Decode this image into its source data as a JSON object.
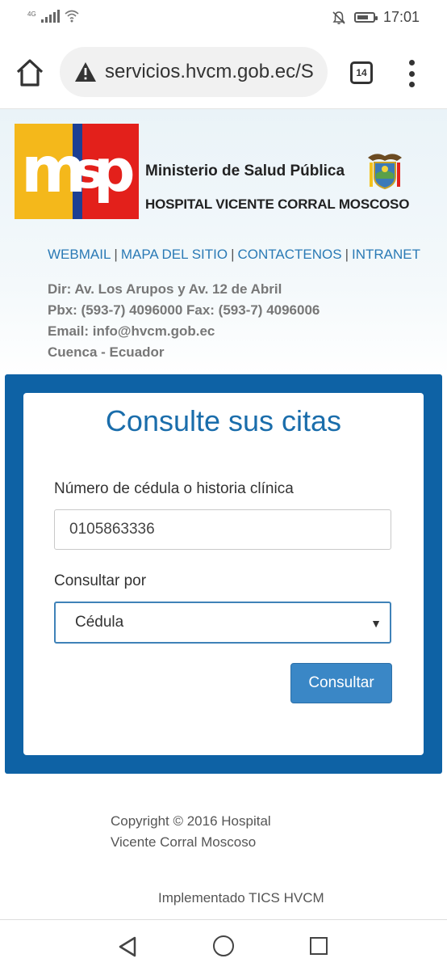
{
  "status_bar": {
    "network": "4G",
    "time": "17:01",
    "battery_level": 0.7
  },
  "browser": {
    "url": "servicios.hvcm.gob.ec/S",
    "tab_count": "14"
  },
  "header": {
    "logo_letters": {
      "m": "m",
      "s": "s",
      "p": "p"
    },
    "org_name": "Ministerio de Salud Pública",
    "hospital_name": "HOSPITAL VICENTE CORRAL MOSCOSO"
  },
  "links": {
    "webmail": "WEBMAIL",
    "sitemap": "MAPA DEL SITIO",
    "contact": "CONTACTENOS",
    "intranet": "INTRANET",
    "separator": "|"
  },
  "contact": {
    "address": "Dir: Av. Los Arupos y Av. 12 de Abril",
    "phone": "Pbx: (593-7) 4096000 Fax: (593-7) 4096006",
    "email": "Email: info@hvcm.gob.ec",
    "city": "Cuenca - Ecuador"
  },
  "form": {
    "title": "Consulte sus citas",
    "id_label": "Número de cédula o historia clínica",
    "id_value": "0105863336",
    "query_by_label": "Consultar por",
    "query_by_value": "Cédula",
    "submit_label": "Consultar"
  },
  "footer": {
    "copyright_line1": "Copyright © 2016 Hospital",
    "copyright_line2": "Vicente Corral Moscoso",
    "implemented": "Implementado TICS HVCM"
  },
  "colors": {
    "primary_blue": "#0e62a5",
    "link_blue": "#2a7ab5",
    "button_blue": "#3a87c6",
    "logo_yellow": "#f4b81b",
    "logo_red": "#e3201b"
  }
}
